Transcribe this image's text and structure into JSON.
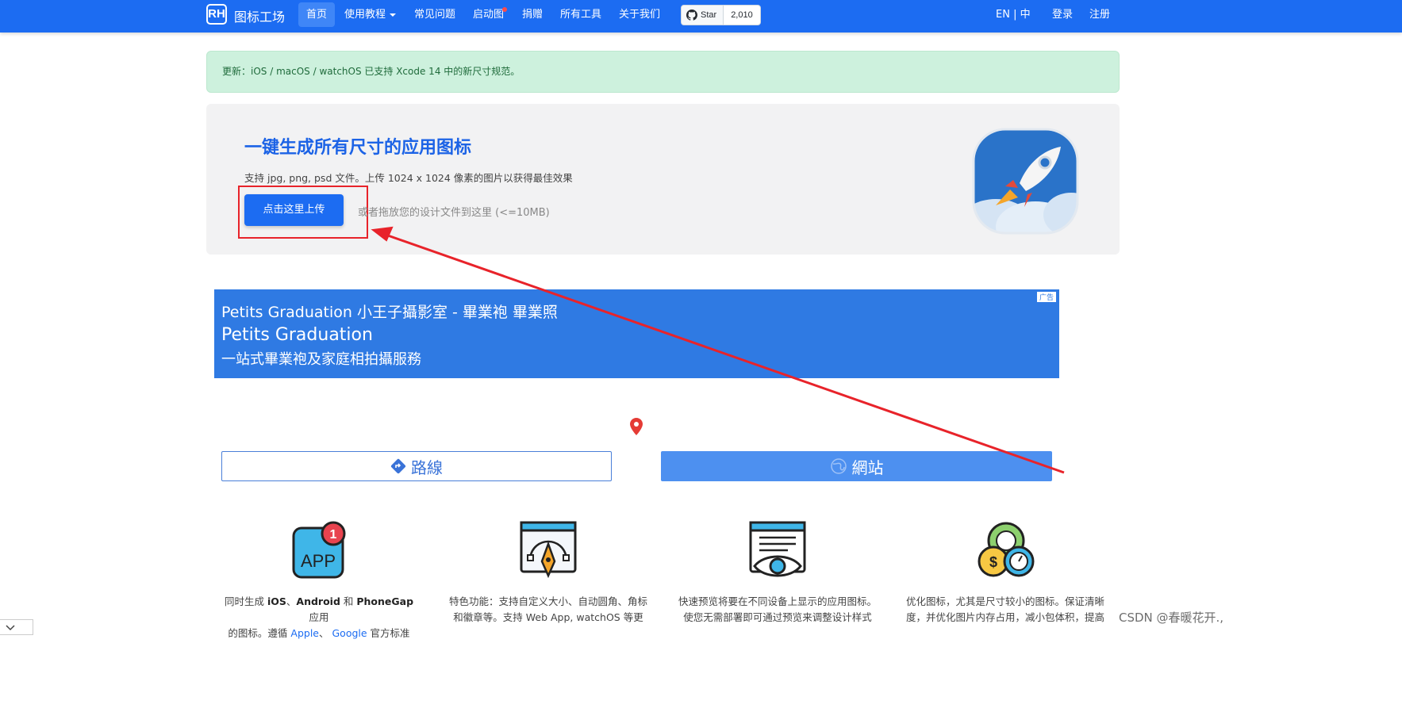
{
  "nav": {
    "logo": "RH",
    "brand": "图标工场",
    "items": [
      "首页",
      "使用教程",
      "常见问题",
      "启动图",
      "捐赠",
      "所有工具",
      "关于我们"
    ],
    "github_star": "Star",
    "github_count": "2,010",
    "lang": "EN | 中",
    "login": "登录",
    "register": "注册"
  },
  "alert": {
    "text": "更新：iOS / macOS / watchOS 已支持 Xcode 14 中的新尺寸规范。"
  },
  "hero": {
    "title": "一键生成所有尺寸的应用图标",
    "desc": "支持 jpg, png, psd 文件。上传 1024 x 1024 像素的图片以获得最佳效果",
    "upload_button": "点击这里上传",
    "drop_hint": "或者拖放您的设计文件到这里 (<=10MB)"
  },
  "ad": {
    "badge": "广告",
    "line1": "Petits Graduation 小王子攝影室 - 畢業袍 畢業照",
    "line2": "Petits Graduation",
    "line3": "一站式畢業袍及家庭相拍攝服務",
    "route_button": "路線",
    "website_button": "網站"
  },
  "features": [
    {
      "icon": "app-badge-icon",
      "badge_count": "1",
      "icon_text": "APP",
      "parts": [
        "同时生成 ",
        "iOS",
        "、",
        "Android",
        " 和 ",
        "PhoneGap",
        " 应用",
        "的图标。遵循 ",
        "Apple",
        "、 ",
        "Google",
        " 官方标准"
      ]
    },
    {
      "icon": "pen-tool-icon",
      "text": "特色功能：支持自定义大小、自动圆角、角标和徽章等。支持 Web App, watchOS 等更多平台"
    },
    {
      "icon": "preview-eye-icon",
      "text": "快速预览将要在不同设备上显示的应用图标。使您无需部署即可通过预览来调整设计样式"
    },
    {
      "icon": "optimize-money-icon",
      "text": "优化图标，尤其是尺寸较小的图标。保证清晰度，并优化图片内存占用，减小包体积，提高性能"
    }
  ],
  "watermark": "CSDN @春暖花开.,",
  "colors": {
    "primary": "#1c6cf2",
    "alert_bg": "#cdf1dd",
    "annotation": "#e8232a"
  }
}
